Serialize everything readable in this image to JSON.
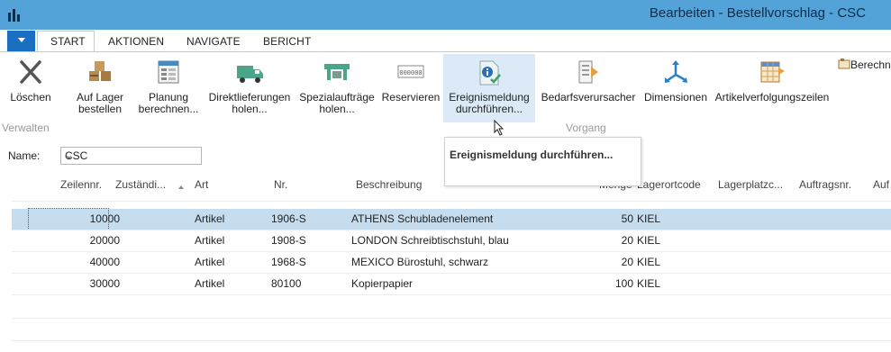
{
  "window": {
    "title": "Bearbeiten - Bestellvorschlag - CSC"
  },
  "tabs": [
    {
      "label": "START",
      "active": true
    },
    {
      "label": "AKTIONEN"
    },
    {
      "label": "NAVIGATE"
    },
    {
      "label": "BERICHT"
    }
  ],
  "ribbon": {
    "buttons": [
      {
        "label": "Löschen",
        "icon": "delete-x-icon"
      },
      {
        "label": "Auf Lager\nbestellen",
        "icon": "stock-boxes-icon"
      },
      {
        "label": "Planung\nberechnen...",
        "icon": "planning-sheet-icon"
      },
      {
        "label": "Direktlieferungen\nholen...",
        "icon": "truck-icon"
      },
      {
        "label": "Spezialaufträge\nholen...",
        "icon": "special-order-icon"
      },
      {
        "label": "Reservieren",
        "icon": "reserve-icon"
      },
      {
        "label": "Ereignismeldung\ndurchführen...",
        "icon": "action-message-icon"
      },
      {
        "label": "Bedarfsverursacher",
        "icon": "demand-originator-icon"
      },
      {
        "label": "Dimensionen",
        "icon": "dimensions-icon"
      },
      {
        "label": "Artikelverfolgungszeilen",
        "icon": "item-tracking-icon"
      },
      {
        "label": "Berechn",
        "icon": "calculate-icon"
      }
    ],
    "groups": [
      {
        "label": "Verwalten"
      },
      {
        "label": "Vorgang"
      }
    ]
  },
  "tooltip": {
    "text": "Ereignismeldung durchführen..."
  },
  "name_field": {
    "label": "Name:",
    "value": "CSC"
  },
  "table": {
    "columns": [
      "Zeilennr.",
      "Zuständi...",
      "Art",
      "Nr.",
      "Beschreibung",
      "Menge",
      "Lagerortcode",
      "Lagerplatzc...",
      "Auftragsnr.",
      "Auf"
    ],
    "rows": [
      {
        "zeilennr": "10000",
        "art": "Artikel",
        "nr": "1906-S",
        "beschreibung": "ATHENS Schubladenelement",
        "menge": "50",
        "lagerort": "KIEL",
        "selected": true
      },
      {
        "zeilennr": "20000",
        "art": "Artikel",
        "nr": "1908-S",
        "beschreibung": "LONDON Schreibtischstuhl, blau",
        "menge": "20",
        "lagerort": "KIEL"
      },
      {
        "zeilennr": "40000",
        "art": "Artikel",
        "nr": "1968-S",
        "beschreibung": "MEXICO Bürostuhl, schwarz",
        "menge": "20",
        "lagerort": "KIEL"
      },
      {
        "zeilennr": "30000",
        "art": "Artikel",
        "nr": "80100",
        "beschreibung": "Kopierpapier",
        "menge": "100",
        "lagerort": "KIEL"
      }
    ]
  },
  "colors": {
    "titlebar": "#53a3d9",
    "app_menu": "#1a6fc0",
    "selected_row": "#c6dcef",
    "hover_button": "#dbeaf6"
  }
}
